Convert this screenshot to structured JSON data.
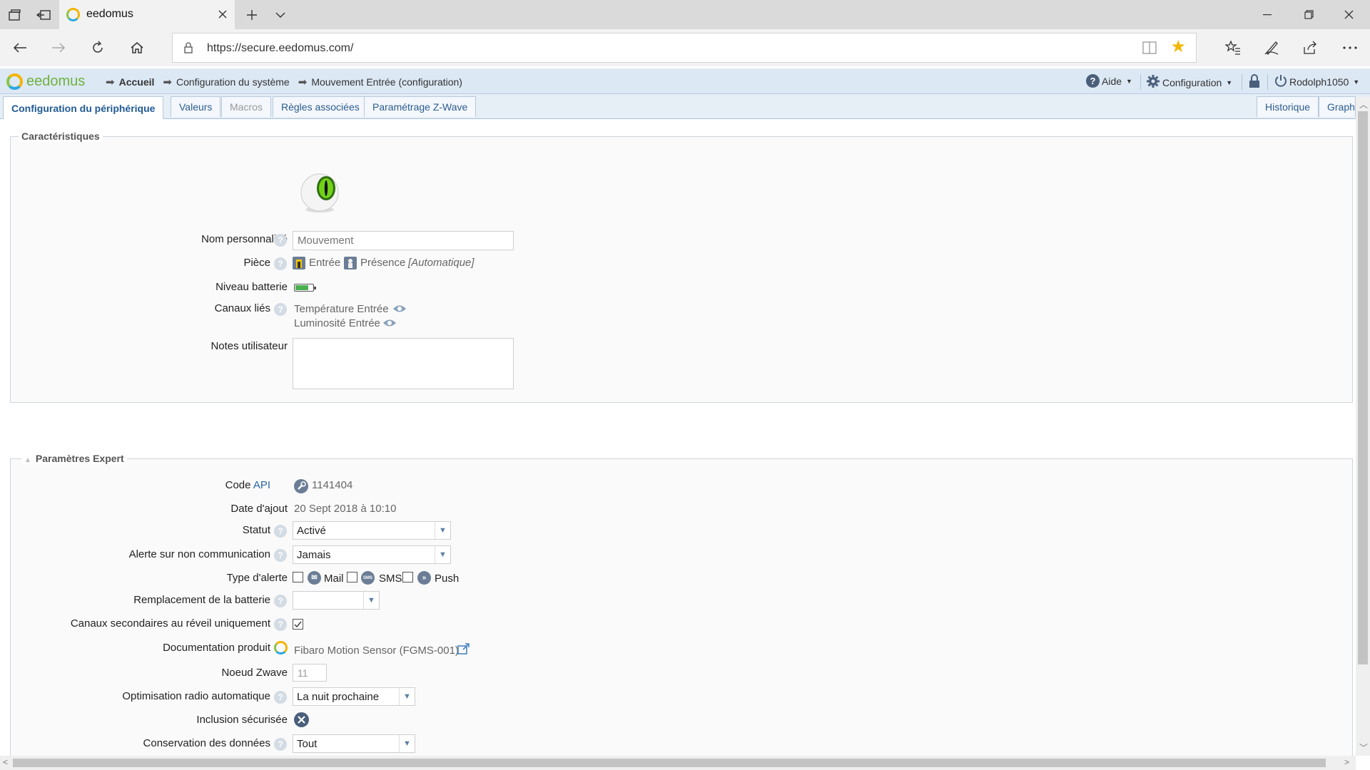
{
  "browser": {
    "tab_title": "eedomus",
    "url": "https://secure.eedomus.com/"
  },
  "header": {
    "logo": "eedomus",
    "breadcrumbs": [
      "Accueil",
      "Configuration du système",
      "Mouvement Entrée (configuration)"
    ],
    "help_label": "Aide",
    "config_label": "Configuration",
    "user_label": "Rodolph1050"
  },
  "tabs": [
    {
      "label": "Configuration du périphérique",
      "active": true
    },
    {
      "label": "Valeurs"
    },
    {
      "label": "Macros",
      "disabled": true
    },
    {
      "label": "Règles associées"
    },
    {
      "label": "Paramétrage Z-Wave"
    }
  ],
  "tabs_right": [
    {
      "label": "Historique"
    },
    {
      "label": "Graphe"
    }
  ],
  "characteristics": {
    "legend": "Caractéristiques",
    "name_label": "Nom personnalisé",
    "name_placeholder": "Mouvement",
    "room_label": "Pièce",
    "room_value": "Entrée",
    "usage_value": "Présence",
    "usage_mode": "[Automatique]",
    "battery_label": "Niveau batterie",
    "battery_level": 0.75,
    "channels_label": "Canaux liés",
    "channels": [
      "Température Entrée",
      "Luminosité Entrée"
    ],
    "notes_label": "Notes utilisateur"
  },
  "expert": {
    "legend": "Paramètres Expert",
    "code_label": "Code",
    "code_api": "API",
    "code_value": "1141404",
    "date_label": "Date d'ajout",
    "date_value": "20 Sept 2018 à 10:10",
    "status_label": "Statut",
    "status_value": "Activé",
    "alert_label": "Alerte sur non communication",
    "alert_value": "Jamais",
    "alert_type_label": "Type d'alerte",
    "alert_types": [
      "Mail",
      "SMS",
      "Push"
    ],
    "battery_repl_label": "Remplacement de la batterie",
    "secondary_label": "Canaux secondaires au réveil uniquement",
    "doc_label": "Documentation produit",
    "doc_link": "Fibaro Motion Sensor (FGMS-001)",
    "node_label": "Noeud Zwave",
    "node_value": "11",
    "radio_label": "Optimisation radio automatique",
    "radio_value": "La nuit prochaine",
    "secure_label": "Inclusion sécurisée",
    "data_label": "Conservation des données",
    "data_value": "Tout"
  }
}
